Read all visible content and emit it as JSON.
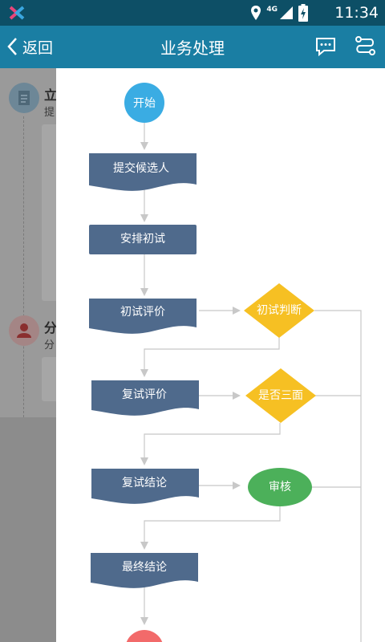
{
  "status_bar": {
    "network_type": "4G",
    "time": "11:34"
  },
  "app_bar": {
    "back_label": "返回",
    "title": "业务处理"
  },
  "background": {
    "items": [
      {
        "title_fragment": "立",
        "subtitle_fragment": "提"
      },
      {
        "title_fragment": "分",
        "subtitle_fragment": "分"
      }
    ]
  },
  "flow": {
    "start_label": "开始",
    "steps": [
      {
        "label": "提交候选人"
      },
      {
        "label": "安排初试"
      },
      {
        "label": "初试评价"
      },
      {
        "label": "复试评价"
      },
      {
        "label": "复试结论"
      },
      {
        "label": "最终结论"
      }
    ],
    "decisions": [
      {
        "label": "初试判断"
      },
      {
        "label": "是否三面"
      }
    ],
    "review_label": "审核"
  },
  "colors": {
    "status_bar": "#0d4f66",
    "app_bar": "#1a7ea3",
    "start_node": "#3aace3",
    "process_node": "#4f6a8c",
    "decision_node": "#f6c023",
    "review_node": "#4cb05a",
    "end_node": "#f26a6a",
    "connector": "#c8c8c8"
  }
}
